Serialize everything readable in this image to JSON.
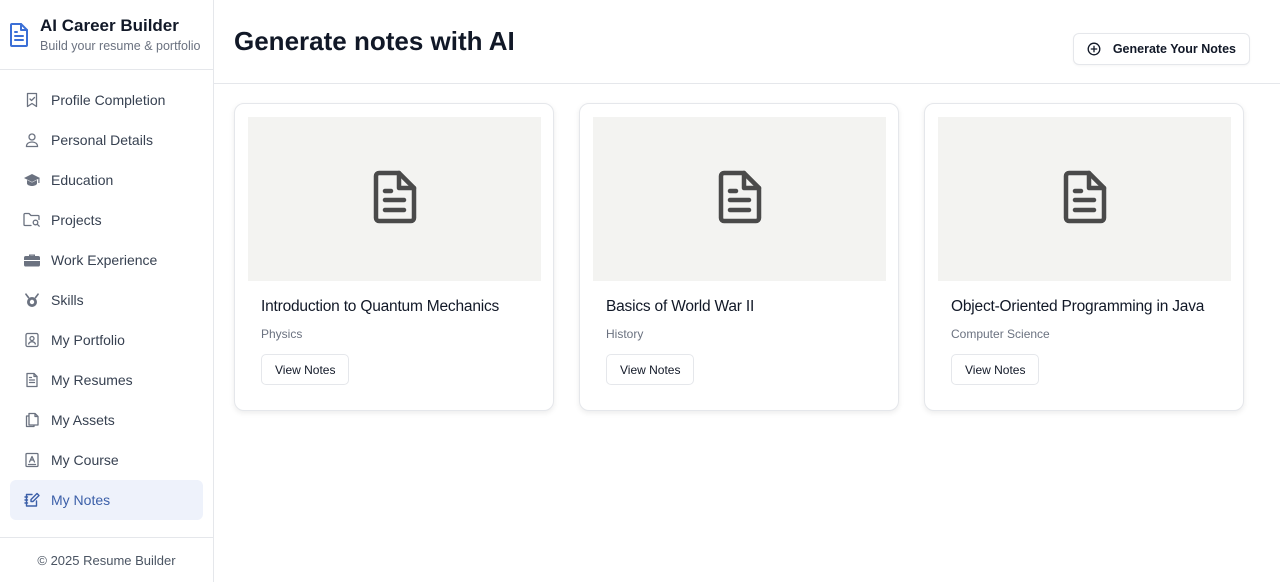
{
  "brand": {
    "title": "AI Career Builder",
    "subtitle": "Build your resume & portfolio",
    "icon": "document-icon"
  },
  "sidebar": {
    "items": [
      {
        "label": "Profile Completion",
        "icon": "bookmark-check-icon",
        "active": false
      },
      {
        "label": "Personal Details",
        "icon": "user-icon",
        "active": false
      },
      {
        "label": "Education",
        "icon": "graduation-cap-icon",
        "active": false
      },
      {
        "label": "Projects",
        "icon": "folder-search-icon",
        "active": false
      },
      {
        "label": "Work Experience",
        "icon": "briefcase-icon",
        "active": false
      },
      {
        "label": "Skills",
        "icon": "skills-icon",
        "active": false
      },
      {
        "label": "My Portfolio",
        "icon": "portfolio-icon",
        "active": false
      },
      {
        "label": "My Resumes",
        "icon": "file-text-icon",
        "active": false
      },
      {
        "label": "My Assets",
        "icon": "copy-icon",
        "active": false
      },
      {
        "label": "My Course",
        "icon": "course-icon",
        "active": false
      },
      {
        "label": "My Notes",
        "icon": "notebook-pen-icon",
        "active": true
      }
    ],
    "footer": "© 2025 Resume Builder"
  },
  "header": {
    "title": "Generate notes with AI",
    "generate_button": "Generate Your Notes",
    "generate_icon": "plus-circle-icon"
  },
  "cards": [
    {
      "title": "Introduction to Quantum Mechanics",
      "category": "Physics",
      "button": "View Notes",
      "icon": "file-text-icon"
    },
    {
      "title": "Basics of World War II",
      "category": "History",
      "button": "View Notes",
      "icon": "file-text-icon"
    },
    {
      "title": "Object-Oriented Programming in Java",
      "category": "Computer Science",
      "button": "View Notes",
      "icon": "file-text-icon"
    }
  ],
  "colors": {
    "accent": "#3b5fa8",
    "active_bg": "#eef2fb",
    "thumb_bg": "#f3f3f1"
  }
}
